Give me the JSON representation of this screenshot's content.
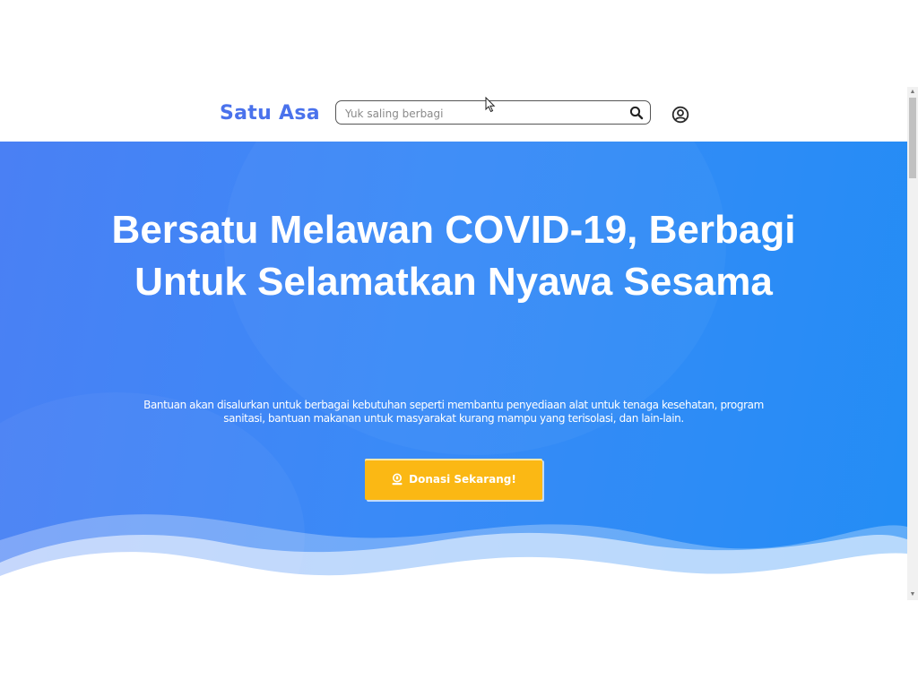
{
  "navbar": {
    "brand": "Satu Asa",
    "search": {
      "placeholder": "Yuk saling berbagi",
      "value": "",
      "icon": "search-icon"
    },
    "user_icon": "user-circle-icon"
  },
  "hero": {
    "title": "Bersatu Melawan COVID-19, Berbagi Untuk Selamatkan Nyawa Sesama",
    "description": "Bantuan akan disalurkan untuk berbagai kebutuhan seperti membantu penyediaan alat untuk tenaga kesehatan, program sanitasi, bantuan makanan untuk masyarakat kurang mampu yang terisolasi, dan lain-lain.",
    "cta": {
      "label": "Donasi Sekarang!",
      "icon": "donate-icon"
    }
  },
  "colors": {
    "brand": "#4a72ec",
    "hero_gradient_start": "#4a80f4",
    "hero_gradient_end": "#238df5",
    "cta_background": "#fbb814"
  },
  "floating_button": {
    "icon": "accessibility-icon"
  }
}
